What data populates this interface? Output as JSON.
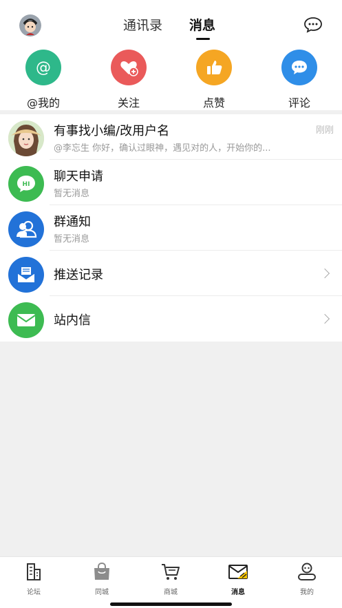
{
  "header": {
    "tabs": [
      {
        "label": "通讯录"
      },
      {
        "label": "消息"
      }
    ]
  },
  "quick_actions": [
    {
      "label": "@我的",
      "icon": "at-icon",
      "color": "#2eb88a"
    },
    {
      "label": "关注",
      "icon": "heart-plus-icon",
      "color": "#ea5a5a"
    },
    {
      "label": "点赞",
      "icon": "thumbs-up-icon",
      "color": "#f5a623"
    },
    {
      "label": "评论",
      "icon": "comment-icon",
      "color": "#2f8ee8"
    }
  ],
  "messages": [
    {
      "title": "有事找小编/改用户名",
      "subtitle": "@李忘生 你好，确认过眼神，遇见对的人，开始你的...",
      "time": "刚刚"
    },
    {
      "title": "聊天申请",
      "subtitle": "暂无消息"
    },
    {
      "title": "群通知",
      "subtitle": "暂无消息"
    },
    {
      "title": "推送记录"
    },
    {
      "title": "站内信"
    }
  ],
  "tabbar": [
    {
      "label": "论坛",
      "icon": "forum-icon"
    },
    {
      "label": "同城",
      "icon": "bag-icon"
    },
    {
      "label": "商城",
      "icon": "cart-icon"
    },
    {
      "label": "消息",
      "icon": "message-envelope-icon",
      "active": true
    },
    {
      "label": "我的",
      "icon": "profile-icon"
    }
  ],
  "colors": {
    "green": "#3dbb52",
    "blue": "#2272d8",
    "accent_yellow": "#f7c400"
  }
}
